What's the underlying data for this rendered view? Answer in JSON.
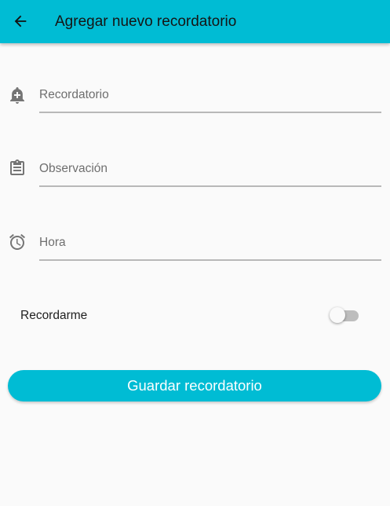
{
  "appbar": {
    "title": "Agregar nuevo recordatorio",
    "back_icon": "arrow-back-icon",
    "color": "#00bcd4"
  },
  "form": {
    "reminder": {
      "placeholder": "Recordatorio",
      "value": "",
      "icon": "add-alert-icon"
    },
    "observation": {
      "placeholder": "Observación",
      "value": "",
      "icon": "clipboard-icon"
    },
    "time": {
      "placeholder": "Hora",
      "value": "",
      "icon": "alarm-clock-icon"
    },
    "remind_me": {
      "label": "Recordarme",
      "enabled": false
    },
    "save_label": "Guardar recordatorio"
  },
  "colors": {
    "accent": "#00bcd4",
    "background": "#fafafa",
    "icon": "#757575"
  }
}
